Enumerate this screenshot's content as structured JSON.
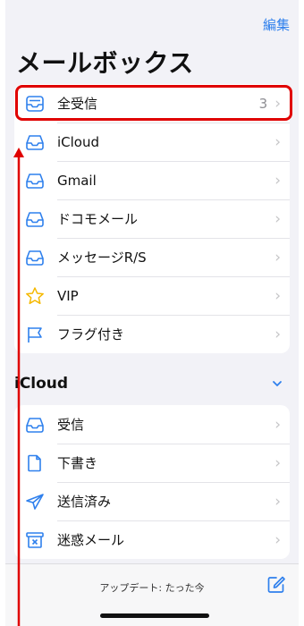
{
  "header": {
    "edit_label": "編集",
    "title": "メールボックス"
  },
  "main_group": {
    "items": [
      {
        "label": "全受信",
        "count": "3",
        "icon": "all-inboxes-icon"
      },
      {
        "label": "iCloud",
        "count": "",
        "icon": "inbox-icon"
      },
      {
        "label": "Gmail",
        "count": "",
        "icon": "inbox-icon"
      },
      {
        "label": "ドコモメール",
        "count": "",
        "icon": "inbox-icon"
      },
      {
        "label": "メッセージR/S",
        "count": "",
        "icon": "inbox-icon"
      },
      {
        "label": "VIP",
        "count": "",
        "icon": "star-icon"
      },
      {
        "label": "フラグ付き",
        "count": "",
        "icon": "flag-icon"
      }
    ]
  },
  "cloud_section": {
    "title": "iCloud",
    "items": [
      {
        "label": "受信",
        "icon": "inbox-icon"
      },
      {
        "label": "下書き",
        "icon": "document-icon"
      },
      {
        "label": "送信済み",
        "icon": "paperplane-icon"
      },
      {
        "label": "迷惑メール",
        "icon": "junk-icon"
      }
    ]
  },
  "toolbar": {
    "status": "アップデート: たった今"
  },
  "colors": {
    "accent": "#2f80ed",
    "highlight": "#e00000",
    "background": "#f2f2f7",
    "chevron": "#c5c5c7"
  }
}
